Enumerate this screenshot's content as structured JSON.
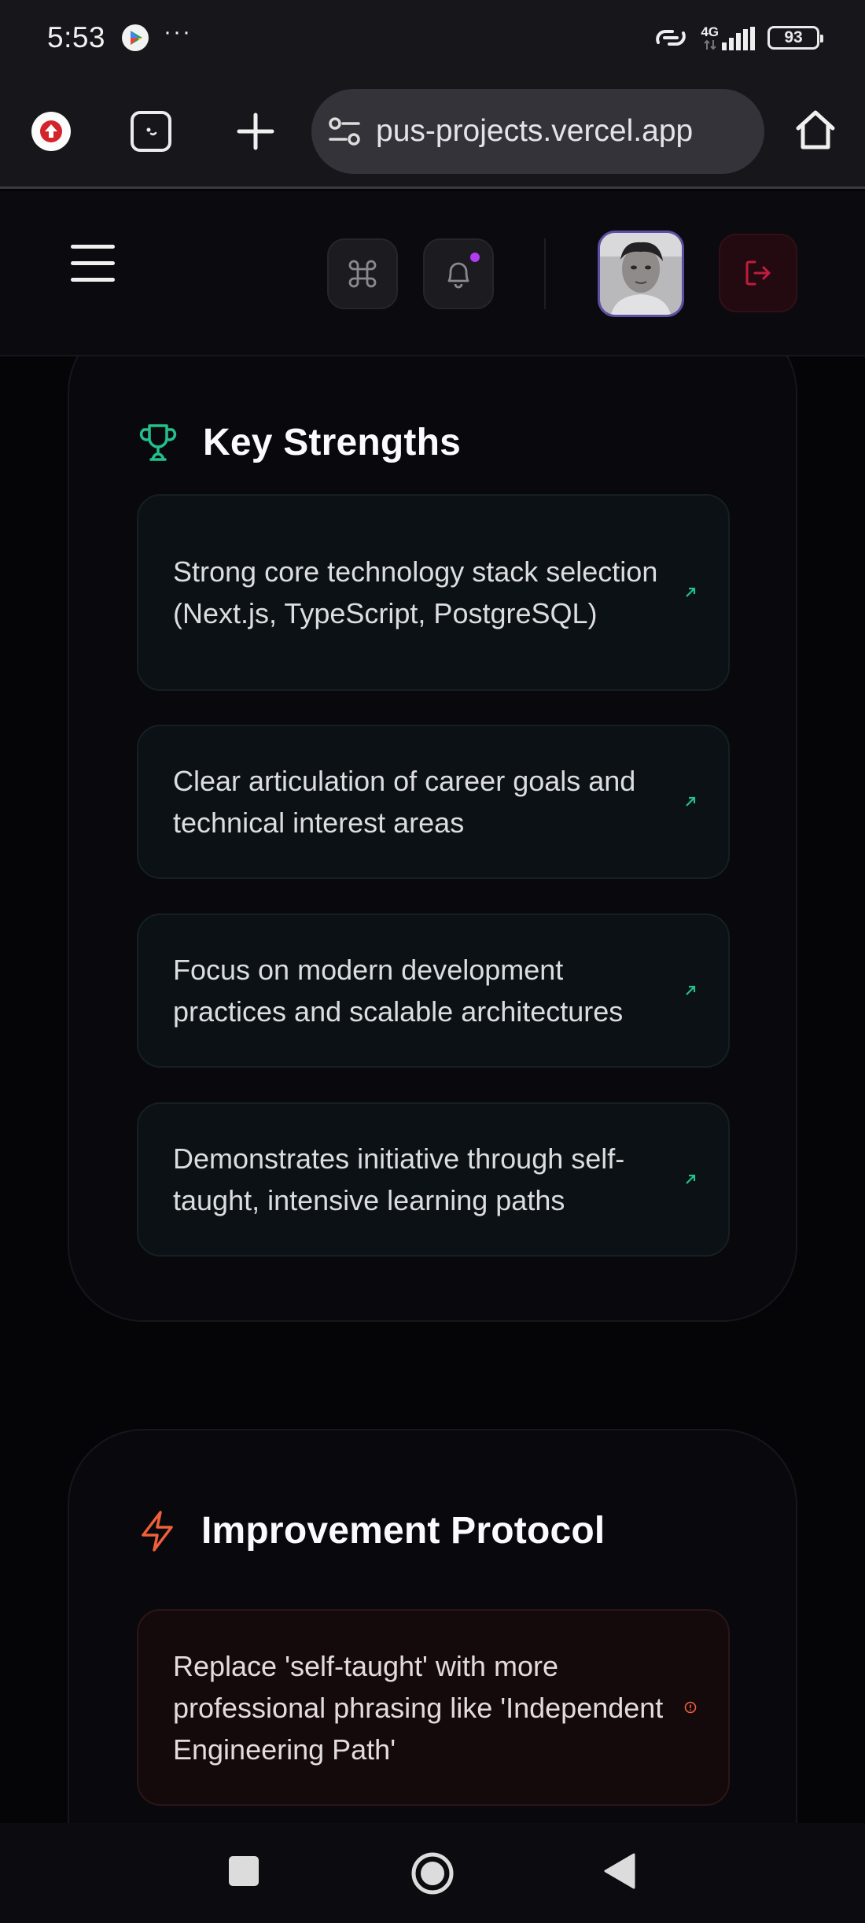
{
  "status_bar": {
    "time": "5:53",
    "overflow_dots": "···",
    "network_label": "4G",
    "battery_level": "93"
  },
  "browser": {
    "url": "pus-projects.vercel.app",
    "icons": [
      "upload-icon",
      "tab-switcher-icon",
      "plus-icon",
      "site-settings-icon",
      "home-icon"
    ]
  },
  "header": {
    "icons": [
      "menu-icon",
      "command-icon",
      "bell-icon",
      "avatar",
      "logout-icon"
    ],
    "accent_colors": {
      "notification_dot": "#b13cf0",
      "logout": "#c01d3c",
      "avatar_border": "#5b4fa8"
    }
  },
  "strengths": {
    "title": "Key Strengths",
    "icon": "trophy-icon",
    "accent": "#22c08a",
    "items": [
      "Strong core technology stack selection (Next.js, TypeScript, PostgreSQL)",
      "Clear articulation of career goals and technical interest areas",
      "Focus on modern development practices and scalable architectures",
      "Demonstrates initiative through self-taught, intensive learning paths"
    ]
  },
  "improvement": {
    "title": "Improvement Protocol",
    "icon": "lightning-icon",
    "accent": "#f0603a",
    "items": [
      "Replace 'self-taught' with more professional phrasing like 'Independent Engineering Path'"
    ]
  },
  "nav_bar": {
    "icons": [
      "recents-square-icon",
      "home-circle-icon",
      "back-triangle-icon"
    ]
  }
}
